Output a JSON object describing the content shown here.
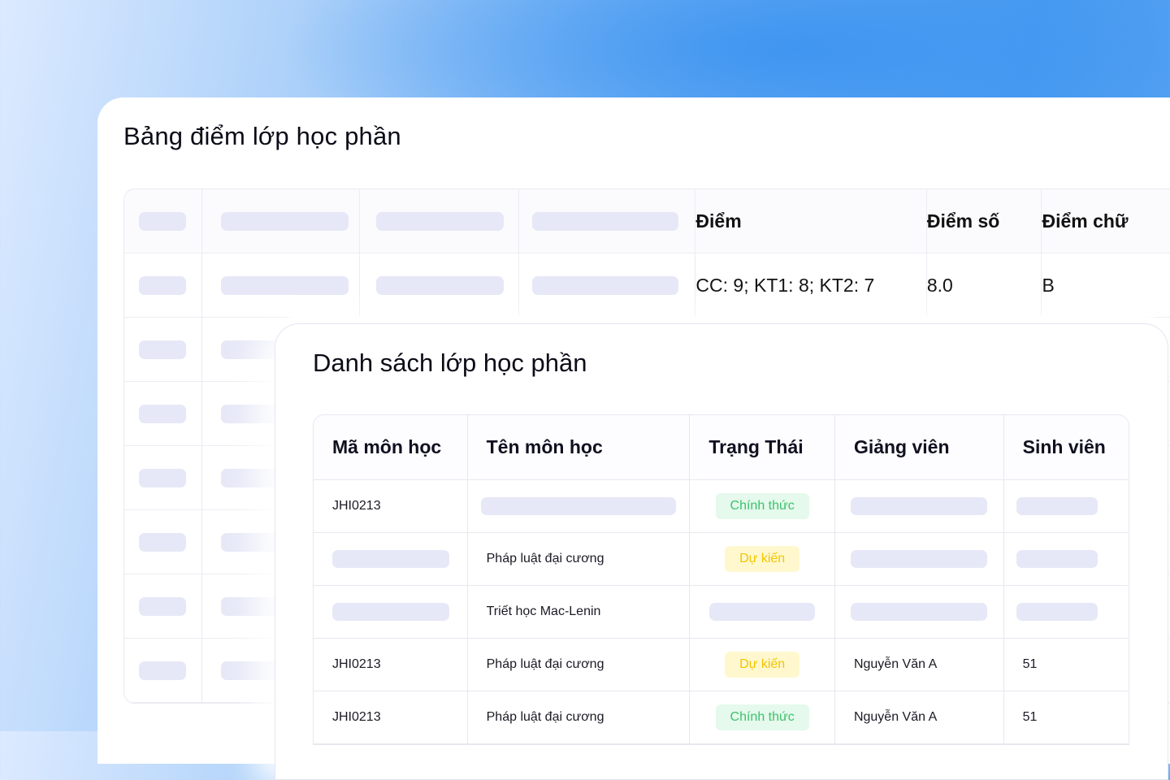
{
  "grades": {
    "title": "Bảng điểm lớp học phần",
    "headers": {
      "diem": "Điểm",
      "diem_so": "Điểm số",
      "diem_chu": "Điểm chữ"
    },
    "row1": {
      "diem": "CC: 9; KT1: 8; KT2: 7",
      "diem_so": "8.0",
      "diem_chu": "B"
    }
  },
  "classes": {
    "title": "Danh sách lớp học phần",
    "headers": [
      "Mã môn học",
      "Tên môn học",
      "Trạng Thái",
      "Giảng viên",
      "Sinh viên"
    ],
    "rows": [
      {
        "code": "JHI0213",
        "name": "",
        "status": "Chính thức",
        "status_type": "green",
        "lecturer": "",
        "students": ""
      },
      {
        "code": "",
        "name": "Pháp luật đại cương",
        "status": "Dự kiến",
        "status_type": "yellow",
        "lecturer": "",
        "students": ""
      },
      {
        "code": "",
        "name": "Triết học Mac-Lenin",
        "status": "",
        "status_type": "",
        "lecturer": "",
        "students": ""
      },
      {
        "code": "JHI0213",
        "name": "Pháp luật đại cương",
        "status": "Dự kiến",
        "status_type": "yellow",
        "lecturer": "Nguyễn Văn A",
        "students": "51"
      },
      {
        "code": "JHI0213",
        "name": "Pháp luật đại cương",
        "status": "Chính thức",
        "status_type": "green",
        "lecturer": "Nguyễn Văn A",
        "students": "51"
      }
    ]
  },
  "colors": {
    "green_text": "#3dc26d",
    "green_bg": "#e5f9ec",
    "yellow_text": "#f3c500",
    "yellow_bg": "#fff8cf",
    "placeholder": "#e6e8f7"
  }
}
